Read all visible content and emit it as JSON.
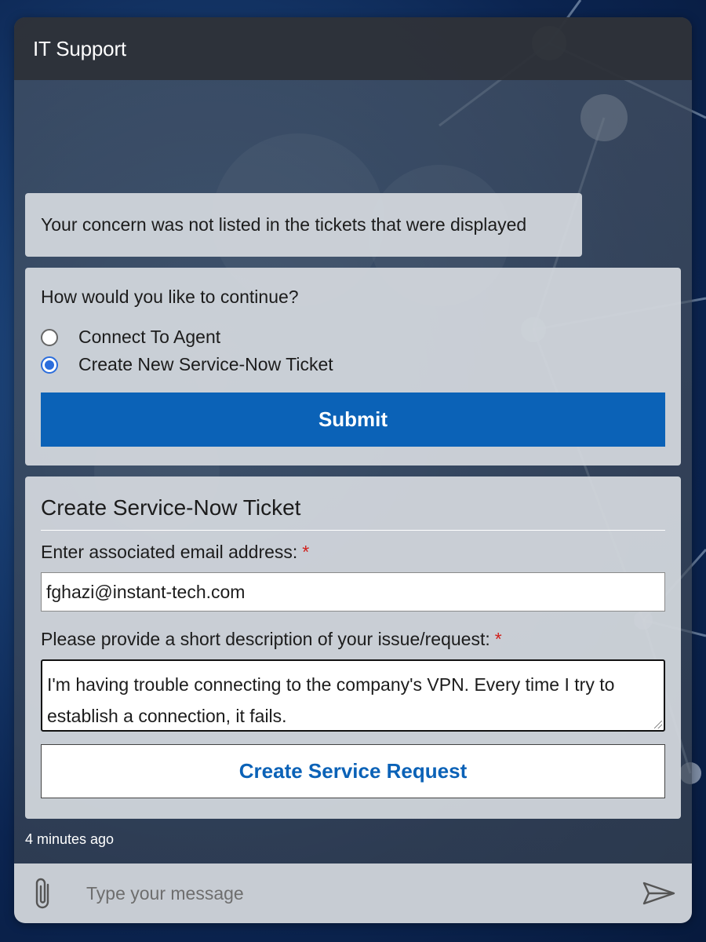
{
  "header": {
    "title": "IT Support"
  },
  "messages": {
    "not_listed": "Your concern was not listed in the tickets that were displayed"
  },
  "choice": {
    "question": "How would you like to continue?",
    "options": [
      {
        "label": "Connect To Agent",
        "selected": false
      },
      {
        "label": "Create New Service-Now Ticket",
        "selected": true
      }
    ],
    "submit_label": "Submit"
  },
  "ticket_form": {
    "title": "Create Service-Now Ticket",
    "email_label": "Enter associated email address:",
    "email_value": "fghazi@instant-tech.com",
    "description_label": "Please provide a short description of your issue/request:",
    "description_value": "I'm having trouble connecting to the company's VPN. Every time I try to establish a connection, it fails.",
    "required_marker": "*",
    "create_label": "Create Service Request"
  },
  "timestamp": "4 minutes ago",
  "composer": {
    "placeholder": "Type your message",
    "attach_icon": "paperclip-icon",
    "send_icon": "send-icon"
  },
  "colors": {
    "accent": "#0b62b7",
    "radio_checked": "#2b6ddc",
    "required": "#d0201c",
    "header_bg": "#2d3036"
  }
}
